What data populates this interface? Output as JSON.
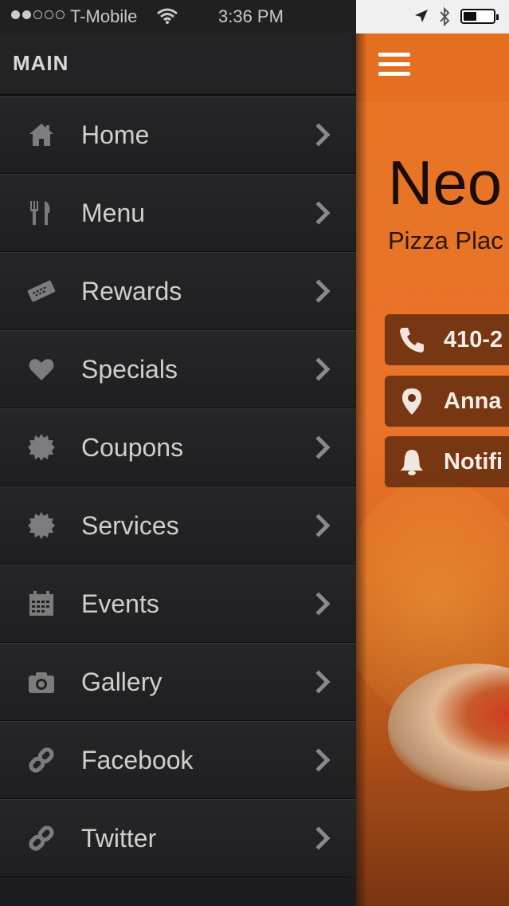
{
  "status_bar": {
    "carrier": "T-Mobile",
    "time": "3:36 PM",
    "signal_icon": "signal-dots-icon",
    "wifi_icon": "wifi-icon",
    "location_icon": "location-arrow-icon",
    "bluetooth_icon": "bluetooth-icon",
    "battery_icon": "battery-icon",
    "battery_level": 0.45
  },
  "sidebar": {
    "section_title": "MAIN",
    "items": [
      {
        "label": "Home",
        "icon": "home-icon"
      },
      {
        "label": "Menu",
        "icon": "fork-knife-icon"
      },
      {
        "label": "Rewards",
        "icon": "ticket-icon"
      },
      {
        "label": "Specials",
        "icon": "heart-icon"
      },
      {
        "label": "Coupons",
        "icon": "badge-icon"
      },
      {
        "label": "Services",
        "icon": "badge-icon"
      },
      {
        "label": "Events",
        "icon": "calendar-icon"
      },
      {
        "label": "Gallery",
        "icon": "camera-icon"
      },
      {
        "label": "Facebook",
        "icon": "link-icon"
      },
      {
        "label": "Twitter",
        "icon": "link-icon"
      }
    ]
  },
  "main": {
    "menu_icon": "hamburger-icon",
    "business_name": "Neo",
    "business_subtitle": "Pizza Plac",
    "buttons": [
      {
        "label": "410-2",
        "icon": "phone-icon"
      },
      {
        "label": "Anna",
        "icon": "map-pin-icon"
      },
      {
        "label": "Notifi",
        "icon": "bell-icon"
      }
    ]
  },
  "colors": {
    "sidebar_bg": "#1d1d1f",
    "accent_orange": "#e46f20",
    "button_brown": "#6a2f0f"
  }
}
